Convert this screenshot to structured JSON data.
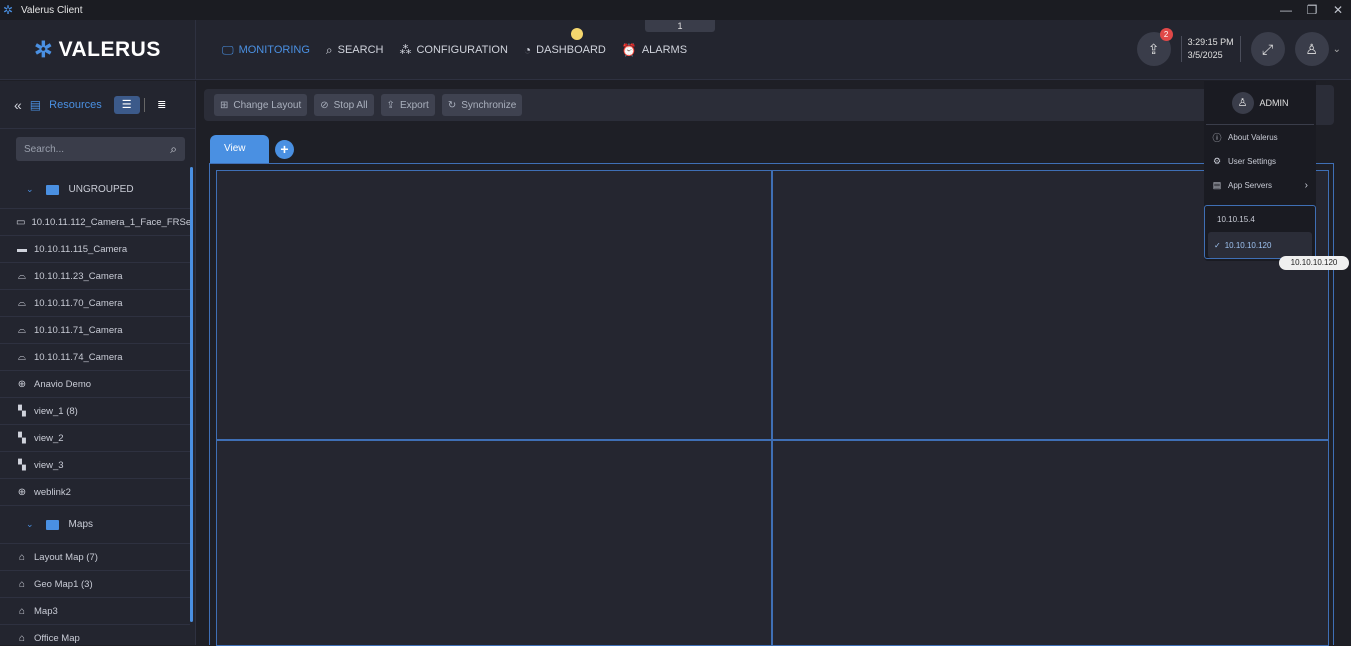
{
  "window": {
    "title": "Valerus Client",
    "controls": [
      "—",
      "❐",
      "✕"
    ]
  },
  "header": {
    "logo": "VALERUS",
    "nav": [
      {
        "label": "MONITORING",
        "icon": "monitor-icon",
        "active": true
      },
      {
        "label": "SEARCH",
        "icon": "search-icon",
        "active": false
      },
      {
        "label": "CONFIGURATION",
        "icon": "configuration-icon",
        "active": false
      },
      {
        "label": "DASHBOARD",
        "icon": "dashboard-icon",
        "active": false
      },
      {
        "label": "ALARMS",
        "icon": "alarm-icon",
        "active": false
      }
    ],
    "tab_indicator": "1",
    "notification_count": "2",
    "time": "3:29:15 PM",
    "date": "3/5/2025"
  },
  "sidebar": {
    "resources_label": "Resources",
    "search_placeholder": "Search...",
    "items": [
      {
        "type": "group",
        "label": "UNGROUPED"
      },
      {
        "type": "item",
        "icon": "camera-box-icon",
        "label": "10.10.11.112_Camera_1_Face_FRSe"
      },
      {
        "type": "item",
        "icon": "camera-bullet-icon",
        "label": "10.10.11.115_Camera"
      },
      {
        "type": "item",
        "icon": "camera-dome-icon",
        "label": "10.10.11.23_Camera"
      },
      {
        "type": "item",
        "icon": "camera-dome-icon",
        "label": "10.10.11.70_Camera"
      },
      {
        "type": "item",
        "icon": "camera-dome-icon",
        "label": "10.10.11.71_Camera"
      },
      {
        "type": "item",
        "icon": "camera-dome-icon",
        "label": "10.10.11.74_Camera"
      },
      {
        "type": "item",
        "icon": "globe-icon",
        "label": "Anavio Demo"
      },
      {
        "type": "item",
        "icon": "view-icon",
        "label": "view_1  (8)"
      },
      {
        "type": "item",
        "icon": "view-icon",
        "label": "view_2"
      },
      {
        "type": "item",
        "icon": "view-icon",
        "label": "view_3"
      },
      {
        "type": "item",
        "icon": "globe-icon",
        "label": "weblink2"
      },
      {
        "type": "group",
        "label": "Maps"
      },
      {
        "type": "item",
        "icon": "map-icon",
        "label": "Layout Map  (7)"
      },
      {
        "type": "item",
        "icon": "map-icon",
        "label": "Geo Map1  (3)"
      },
      {
        "type": "item",
        "icon": "map-icon",
        "label": "Map3"
      },
      {
        "type": "item",
        "icon": "map-icon",
        "label": "Office Map"
      }
    ]
  },
  "toolbar": {
    "change_layout": "Change Layout",
    "stop_all": "Stop All",
    "export": "Export",
    "synchronize": "Synchronize"
  },
  "views": {
    "active_tab": "View"
  },
  "user_menu": {
    "user": "ADMIN",
    "items": [
      "About Valerus",
      "User Settings",
      "App Servers"
    ],
    "servers": [
      "10.10.15.4",
      "10.10.10.120"
    ],
    "selected_server": "10.10.10.120",
    "tooltip": "10.10.10.120"
  },
  "colors": {
    "accent": "#4a90e2",
    "background": "#1e1f26",
    "panel": "#23252f",
    "badge": "#e04848"
  }
}
